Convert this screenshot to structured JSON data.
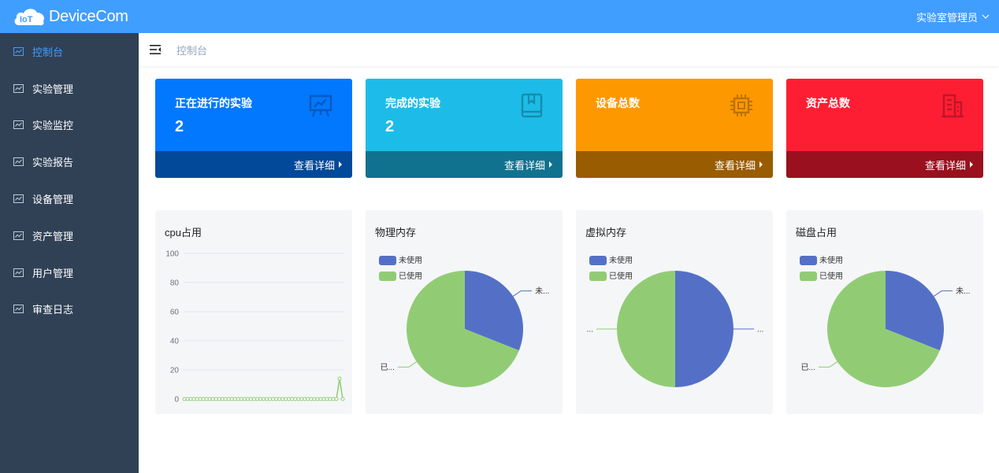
{
  "header": {
    "logo_text": "DeviceCom",
    "user_name": "实验室管理员"
  },
  "sidebar": {
    "items": [
      {
        "label": "控制台"
      },
      {
        "label": "实验管理"
      },
      {
        "label": "实验监控"
      },
      {
        "label": "实验报告"
      },
      {
        "label": "设备管理"
      },
      {
        "label": "资产管理"
      },
      {
        "label": "用户管理"
      },
      {
        "label": "审查日志"
      }
    ]
  },
  "breadcrumb": {
    "current": "控制台"
  },
  "stat_cards": [
    {
      "title": "正在进行的实验",
      "value": "2",
      "link": "查看详细",
      "color": "#0178fe",
      "foot_color": "#03499a",
      "icon": "presentation-chart-icon"
    },
    {
      "title": "完成的实验",
      "value": "2",
      "link": "查看详细",
      "color": "#1dbce8",
      "foot_color": "#10728f",
      "icon": "book-icon"
    },
    {
      "title": "设备总数",
      "value": "",
      "link": "查看详细",
      "color": "#fe9801",
      "foot_color": "#9a5c01",
      "icon": "chip-icon"
    },
    {
      "title": "资产总数",
      "value": "",
      "link": "查看详细",
      "color": "#fe1e33",
      "foot_color": "#9a101e",
      "icon": "building-icon"
    }
  ],
  "panels": {
    "cpu_title": "cpu占用",
    "mem_title": "物理内存",
    "vmem_title": "虚拟内存",
    "disk_title": "磁盘占用"
  },
  "chart_data": [
    {
      "type": "line",
      "title": "cpu占用",
      "ylim": [
        0,
        100
      ],
      "yticks": [
        "100",
        "80",
        "60",
        "40",
        "20",
        "0"
      ],
      "series": [
        {
          "values": [
            0,
            0,
            0,
            0,
            0,
            0,
            0,
            0,
            0,
            0,
            0,
            0,
            0,
            0,
            0,
            0,
            0,
            0,
            0,
            0,
            0,
            0,
            0,
            0,
            0,
            0,
            0,
            0,
            0,
            0,
            0,
            0,
            0,
            0,
            0,
            0,
            0,
            0,
            0,
            0,
            0,
            0,
            0,
            0,
            0,
            0,
            0,
            0,
            0,
            14,
            0
          ]
        }
      ],
      "color": "#91cc75"
    },
    {
      "type": "pie",
      "title": "物理内存",
      "legend": [
        "未使用",
        "已使用"
      ],
      "values": [
        31,
        69
      ],
      "labels": [
        "未...",
        "已..."
      ],
      "colors": [
        "#5470c6",
        "#91cc75"
      ]
    },
    {
      "type": "pie",
      "title": "虚拟内存",
      "legend": [
        "未使用",
        "已使用"
      ],
      "values": [
        50,
        50
      ],
      "labels": [
        "...",
        "..."
      ],
      "colors": [
        "#5470c6",
        "#91cc75"
      ]
    },
    {
      "type": "pie",
      "title": "磁盘占用",
      "legend": [
        "未使用",
        "已使用"
      ],
      "values": [
        31,
        69
      ],
      "labels": [
        "未...",
        "已..."
      ],
      "colors": [
        "#5470c6",
        "#91cc75"
      ]
    }
  ]
}
